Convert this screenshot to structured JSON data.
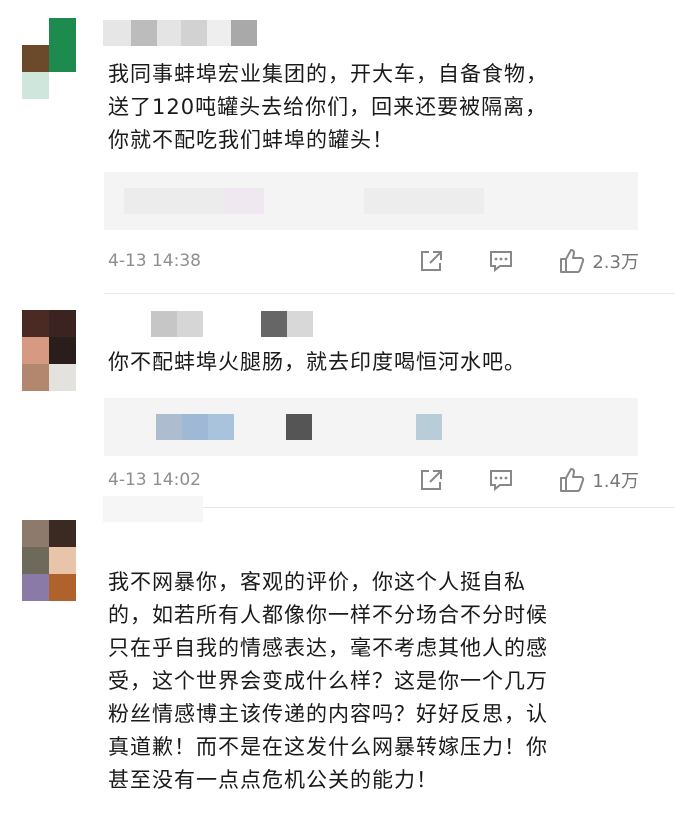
{
  "comments": [
    {
      "lines": [
        "我同事蚌埠宏业集团的，开大车，自备食物，",
        "送了120吨罐头去给你们，回来还要被隔离，",
        "你就不配吃我们蚌埠的罐头！"
      ],
      "time": "4-13 14:38",
      "likes": "2.3万"
    },
    {
      "lines": [
        "你不配蚌埠火腿肠，就去印度喝恒河水吧。"
      ],
      "time": "4-13 14:02",
      "likes": "1.4万"
    },
    {
      "lines": [
        "我不网暴你，客观的评价，你这个人挺自私",
        "的，如若所有人都像你一样不分场合不分时候",
        "只在乎自我的情感表达，毫不考虑其他人的感",
        "受，这个世界会变成什么样？这是你一个几万",
        "粉丝情感博主该传递的内容吗？好好反思，认",
        "真道歉！而不是在这发什么网暴转嫁压力！你",
        "甚至没有一点点危机公关的能力！"
      ]
    }
  ],
  "icons": [
    "share-icon",
    "comment-icon",
    "like-icon"
  ]
}
